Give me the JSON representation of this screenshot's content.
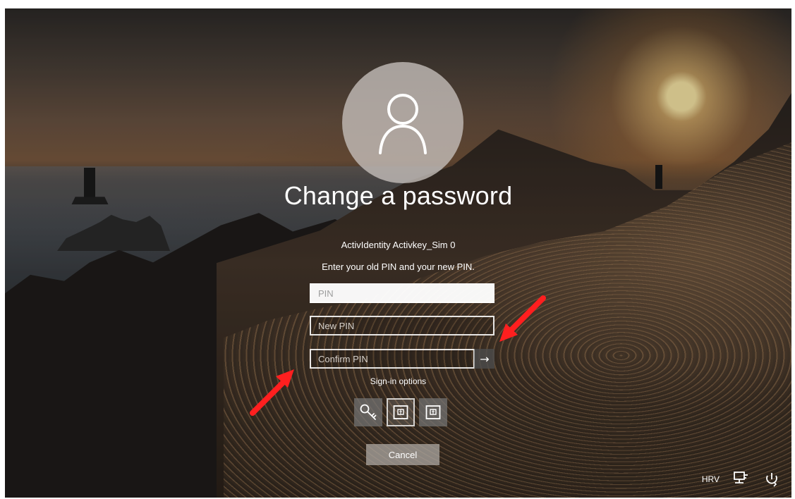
{
  "screen": {
    "title": "Change a password",
    "account_name": "ActivIdentity Activkey_Sim 0",
    "instruction": "Enter your old PIN and your new PIN."
  },
  "fields": {
    "old_pin_placeholder": "PIN",
    "new_pin_placeholder": "New PIN",
    "confirm_pin_placeholder": "Confirm PIN"
  },
  "sign_in": {
    "label": "Sign-in options",
    "options": [
      "key-icon",
      "smart-card-icon",
      "smart-card-icon"
    ]
  },
  "actions": {
    "cancel_label": "Cancel",
    "submit_icon": "→"
  },
  "status": {
    "language": "HRV",
    "network_icon": "network-icon",
    "power_icon": "power-icon"
  },
  "annotations": {
    "arrow_color": "#ff1f1f"
  }
}
